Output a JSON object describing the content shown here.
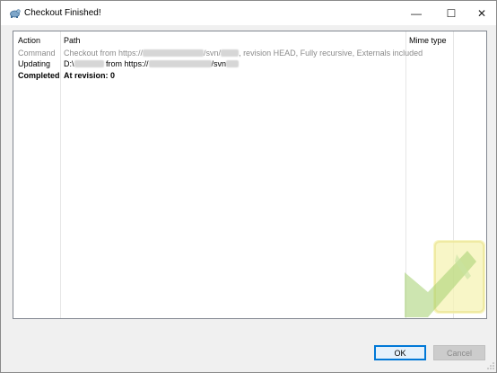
{
  "window": {
    "title": "Checkout Finished!",
    "controls": {
      "minimize": "—",
      "maximize": "☐",
      "close": "✕"
    }
  },
  "list": {
    "columns": {
      "action": "Action",
      "path": "Path",
      "mime": "Mime type"
    },
    "rows": [
      {
        "action": "Command",
        "path_prefix": "Checkout from https://",
        "path_mid": "/svn/",
        "path_suffix": ", revision HEAD, Fully recursive, Externals included",
        "style": "grey"
      },
      {
        "action": "Updating",
        "path_prefix": "D:\\",
        "path_mid": " from https://",
        "path_suffix": "/svn",
        "style": "normal"
      },
      {
        "action": "Completed",
        "path_prefix": "At revision: 0",
        "style": "bold"
      }
    ]
  },
  "buttons": {
    "ok": "OK",
    "cancel": "Cancel"
  },
  "colors": {
    "accent": "#0078d7",
    "watermark_green": "#8cc152",
    "watermark_yellow": "#f3f0a6"
  }
}
